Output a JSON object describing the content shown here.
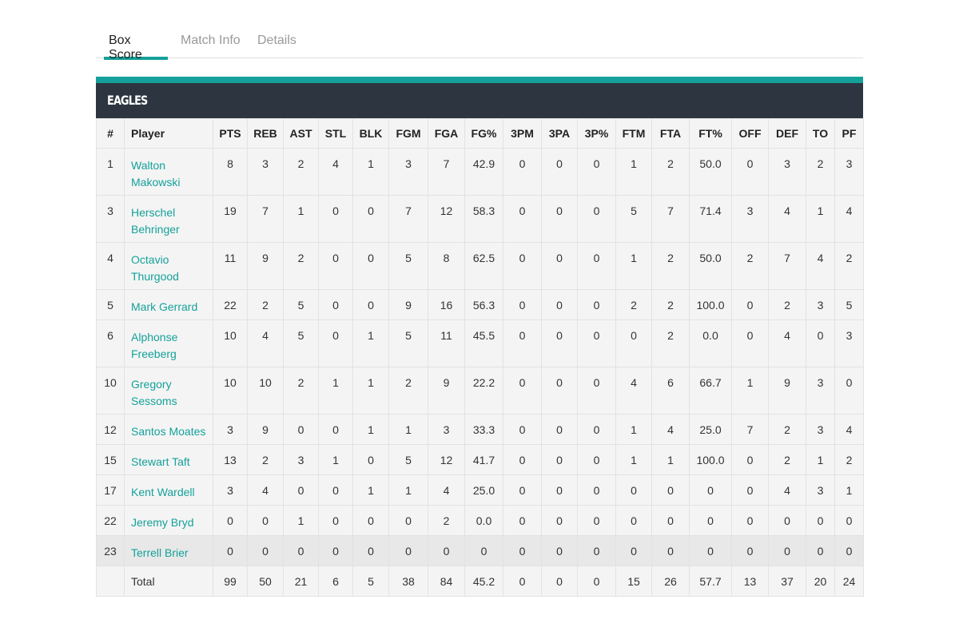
{
  "tabs": [
    {
      "label": "Box Score",
      "active": true
    },
    {
      "label": "Match Info",
      "active": false
    },
    {
      "label": "Details",
      "active": false
    }
  ],
  "team": {
    "name": "EAGLES"
  },
  "colors": {
    "accent": "#14a19a",
    "header_bg": "#2d3640",
    "link": "#14a19a"
  },
  "columns": [
    "#",
    "Player",
    "PTS",
    "REB",
    "AST",
    "STL",
    "BLK",
    "FGM",
    "FGA",
    "FG%",
    "3PM",
    "3PA",
    "3P%",
    "FTM",
    "FTA",
    "FT%",
    "OFF",
    "DEF",
    "TO",
    "PF"
  ],
  "rows": [
    {
      "num": "1",
      "first": "Walton",
      "last": "Makowski",
      "stats": [
        "8",
        "3",
        "2",
        "4",
        "1",
        "3",
        "7",
        "42.9",
        "0",
        "0",
        "0",
        "1",
        "2",
        "50.0",
        "0",
        "3",
        "2",
        "3"
      ]
    },
    {
      "num": "3",
      "first": "Herschel",
      "last": "Behringer",
      "stats": [
        "19",
        "7",
        "1",
        "0",
        "0",
        "7",
        "12",
        "58.3",
        "0",
        "0",
        "0",
        "5",
        "7",
        "71.4",
        "3",
        "4",
        "1",
        "4"
      ]
    },
    {
      "num": "4",
      "first": "Octavio",
      "last": "Thurgood",
      "stats": [
        "11",
        "9",
        "2",
        "0",
        "0",
        "5",
        "8",
        "62.5",
        "0",
        "0",
        "0",
        "1",
        "2",
        "50.0",
        "2",
        "7",
        "4",
        "2"
      ]
    },
    {
      "num": "5",
      "first": "Mark Gerrard",
      "last": "",
      "stats": [
        "22",
        "2",
        "5",
        "0",
        "0",
        "9",
        "16",
        "56.3",
        "0",
        "0",
        "0",
        "2",
        "2",
        "100.0",
        "0",
        "2",
        "3",
        "5"
      ]
    },
    {
      "num": "6",
      "first": "Alphonse",
      "last": "Freeberg",
      "stats": [
        "10",
        "4",
        "5",
        "0",
        "1",
        "5",
        "11",
        "45.5",
        "0",
        "0",
        "0",
        "0",
        "2",
        "0.0",
        "0",
        "4",
        "0",
        "3"
      ]
    },
    {
      "num": "10",
      "first": "Gregory",
      "last": "Sessoms",
      "stats": [
        "10",
        "10",
        "2",
        "1",
        "1",
        "2",
        "9",
        "22.2",
        "0",
        "0",
        "0",
        "4",
        "6",
        "66.7",
        "1",
        "9",
        "3",
        "0"
      ]
    },
    {
      "num": "12",
      "first": "Santos Moates",
      "last": "",
      "stats": [
        "3",
        "9",
        "0",
        "0",
        "1",
        "1",
        "3",
        "33.3",
        "0",
        "0",
        "0",
        "1",
        "4",
        "25.0",
        "7",
        "2",
        "3",
        "4"
      ]
    },
    {
      "num": "15",
      "first": "Stewart Taft",
      "last": "",
      "stats": [
        "13",
        "2",
        "3",
        "1",
        "0",
        "5",
        "12",
        "41.7",
        "0",
        "0",
        "0",
        "1",
        "1",
        "100.0",
        "0",
        "2",
        "1",
        "2"
      ]
    },
    {
      "num": "17",
      "first": "Kent Wardell",
      "last": "",
      "stats": [
        "3",
        "4",
        "0",
        "0",
        "1",
        "1",
        "4",
        "25.0",
        "0",
        "0",
        "0",
        "0",
        "0",
        "0",
        "0",
        "4",
        "3",
        "1"
      ]
    },
    {
      "num": "22",
      "first": "Jeremy Bryd",
      "last": "",
      "stats": [
        "0",
        "0",
        "1",
        "0",
        "0",
        "0",
        "2",
        "0.0",
        "0",
        "0",
        "0",
        "0",
        "0",
        "0",
        "0",
        "0",
        "0",
        "0"
      ]
    },
    {
      "num": "23",
      "first": "Terrell Brier",
      "last": "",
      "highlighted": true,
      "stats": [
        "0",
        "0",
        "0",
        "0",
        "0",
        "0",
        "0",
        "0",
        "0",
        "0",
        "0",
        "0",
        "0",
        "0",
        "0",
        "0",
        "0",
        "0"
      ]
    }
  ],
  "total": {
    "label": "Total",
    "stats": [
      "99",
      "50",
      "21",
      "6",
      "5",
      "38",
      "84",
      "45.2",
      "0",
      "0",
      "0",
      "15",
      "26",
      "57.7",
      "13",
      "37",
      "20",
      "24"
    ]
  }
}
